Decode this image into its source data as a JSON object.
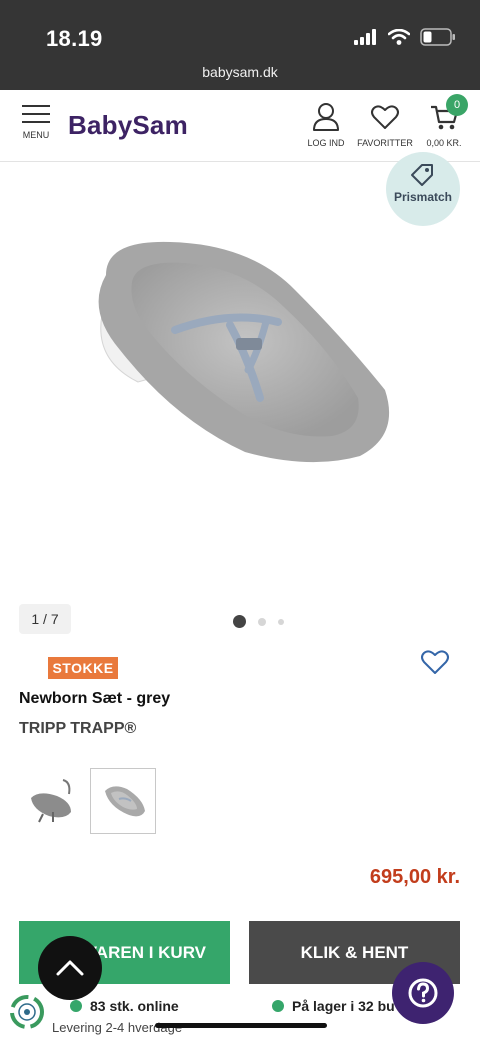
{
  "status_bar": {
    "time": "18.19",
    "url": "babysam.dk"
  },
  "header": {
    "menu_label": "MENU",
    "logo": "BabySam",
    "login_label": "LOG IND",
    "favorites_label": "FAVORITTER",
    "cart_total": "0,00 KR.",
    "cart_count": "0"
  },
  "gallery": {
    "prismatch_label": "Prismatch",
    "counter": "1 / 7",
    "slide_count": 3,
    "active_slide": 0
  },
  "product": {
    "brand": "STOKKE",
    "title": "Newborn Sæt - grey",
    "subtitle": "TRIPP TRAPP®",
    "price": "695,00 kr."
  },
  "actions": {
    "add_to_cart": "VAREN I KURV",
    "click_collect": "KLIK & HENT",
    "help_icon": "question-icon",
    "scroll_top_icon": "chevron-up-icon"
  },
  "stock": {
    "online": "83 stk. online",
    "stores": "På lager i 32 bu",
    "delivery": "Levering 2-4 hverdage"
  },
  "colors": {
    "brand_purple": "#3d2364",
    "green": "#35a66a",
    "price_red": "#c23d1c",
    "dark_button": "#4a4a4a"
  }
}
